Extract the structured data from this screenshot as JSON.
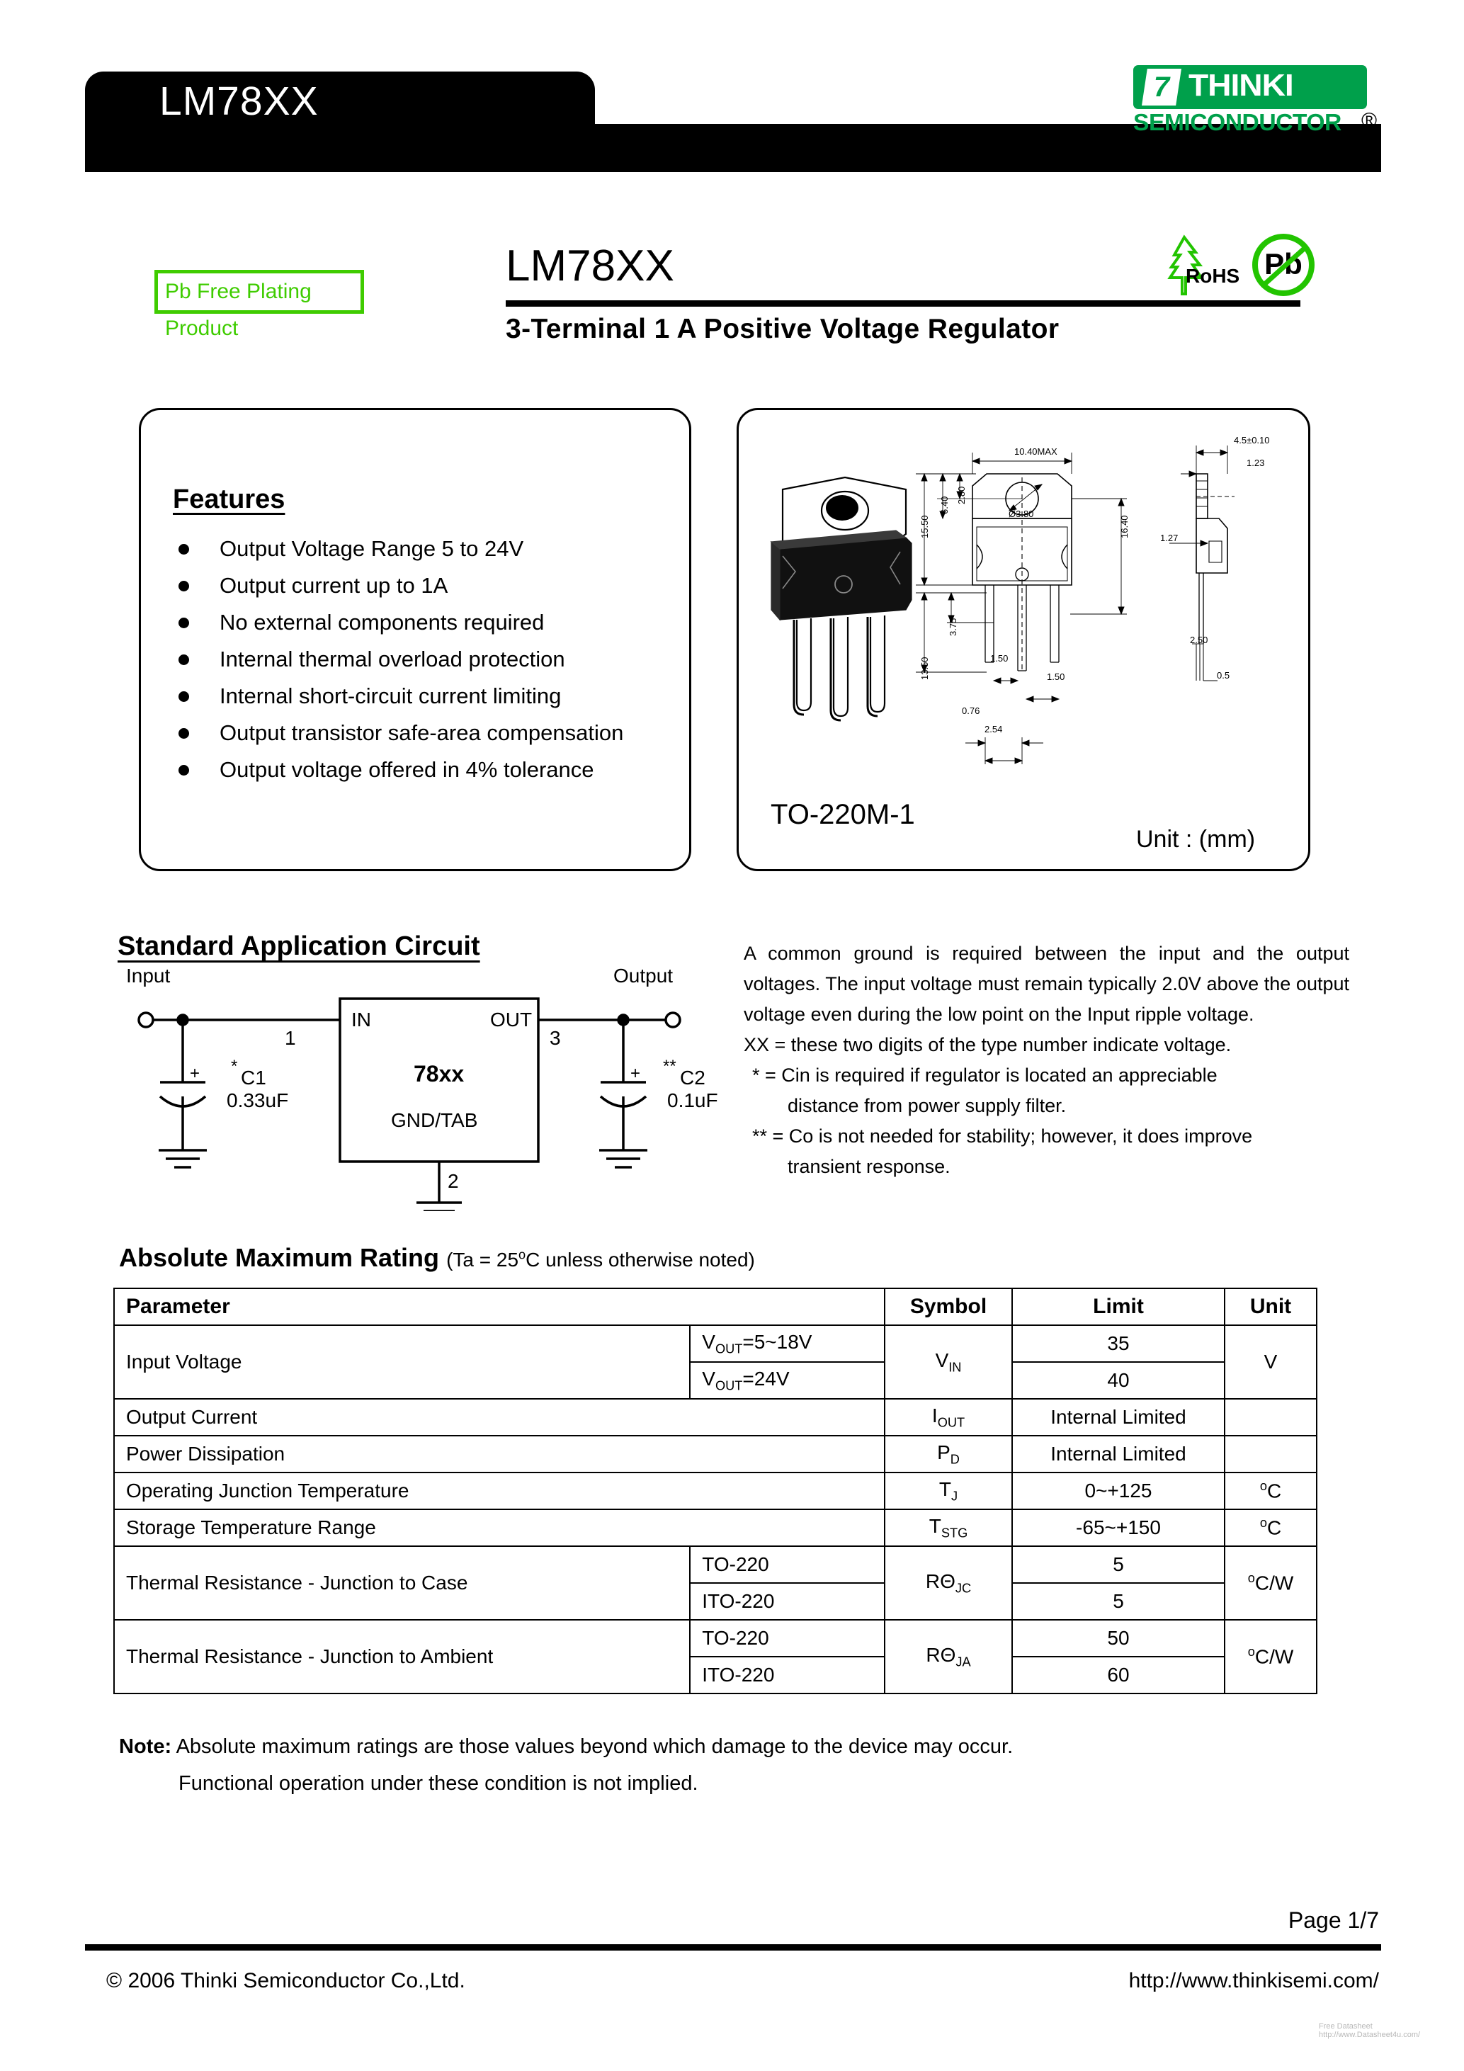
{
  "header": {
    "part_tab": "LM78XX",
    "logo": {
      "mark": "7",
      "brand": "THINKI",
      "sub": "SEMICONDUCTOR",
      "registered": "®",
      "green": "#00A04B"
    }
  },
  "title_block": {
    "pb_free_badge": "Pb Free Plating Product",
    "pb_free_color": "#3FCC00",
    "part_number": "LM78XX",
    "subtitle": "3-Terminal 1 A Positive Voltage Regulator",
    "rohs_label": "RoHS",
    "pb_badge_label": "Pb"
  },
  "features": {
    "heading": "Features",
    "items": [
      "Output Voltage Range 5 to 24V",
      "Output current up to 1A",
      "No external components required",
      "Internal thermal overload protection",
      "Internal short-circuit current limiting",
      "Output transistor safe-area compensation",
      "Output voltage offered in 4% tolerance"
    ]
  },
  "package": {
    "name": "TO-220M-1",
    "unit": "Unit : (mm)",
    "dimensions": {
      "width_max": "10.40MAX",
      "thickness": "4.5±0.10",
      "tab_thickness": "1.23",
      "hole_offset": "2.80",
      "upper_body": "6.40",
      "body_height": "15.50",
      "total_height": "16.40",
      "hole_dia": "Ø3.80",
      "shoulder": "3.75",
      "lead_length": "13.50",
      "side_step": "1.27",
      "lead_gap_a": "1.50",
      "lead_gap_b": "1.50",
      "lead_width": "0.76",
      "lead_pitch": "2.54",
      "lead_base": "2.50",
      "lead_thk": "0.5"
    }
  },
  "application_circuit": {
    "heading": "Standard Application Circuit",
    "input_label": "Input",
    "output_label": "Output",
    "pin1": "1",
    "pin2": "2",
    "pin3": "3",
    "in_label": "IN",
    "out_label": "OUT",
    "device": "78xx",
    "gnd_label": "GND/TAB",
    "c1_star": "*",
    "c1_name": "C1",
    "c1_value": "0.33uF",
    "c1_plus": "+",
    "c2_star": "**",
    "c2_name": "C2",
    "c2_value": "0.1uF",
    "c2_plus": "+"
  },
  "description": {
    "p1": "A common ground is required between the input and the output voltages. The input voltage must remain typically 2.0V above the output voltage even during the low point on the Input ripple voltage.",
    "p2": "XX = these two digits of the type number indicate voltage.",
    "p3a": "* = Cin is required if regulator is located an appreciable",
    "p3b": "distance from power supply filter.",
    "p4a": "** = Co is not needed for stability; however, it does improve",
    "p4b": "transient response."
  },
  "abs_max_rating": {
    "title": "Absolute Maximum Rating",
    "condition": "(Ta = 25°C unless otherwise noted)",
    "columns": [
      "Parameter",
      "Symbol",
      "Limit",
      "Unit"
    ],
    "rows": [
      {
        "parameter": "Input Voltage",
        "conditions": [
          "V_OUT=5~18V",
          "V_OUT=24V"
        ],
        "symbol": "V_IN",
        "limits": [
          "35",
          "40"
        ],
        "unit": "V"
      },
      {
        "parameter": "Output Current",
        "conditions": [],
        "symbol": "I_OUT",
        "limits": [
          "Internal Limited"
        ],
        "unit": ""
      },
      {
        "parameter": "Power Dissipation",
        "conditions": [],
        "symbol": "P_D",
        "limits": [
          "Internal Limited"
        ],
        "unit": ""
      },
      {
        "parameter": "Operating Junction Temperature",
        "conditions": [],
        "symbol": "T_J",
        "limits": [
          "0~+125"
        ],
        "unit": "°C"
      },
      {
        "parameter": "Storage Temperature Range",
        "conditions": [],
        "symbol": "T_STG",
        "limits": [
          "-65~+150"
        ],
        "unit": "°C"
      },
      {
        "parameter": "Thermal Resistance - Junction to Case",
        "conditions": [
          "TO-220",
          "ITO-220"
        ],
        "symbol": "RΘ_JC",
        "limits": [
          "5",
          "5"
        ],
        "unit": "°C/W"
      },
      {
        "parameter": "Thermal Resistance - Junction to Ambient",
        "conditions": [
          "TO-220",
          "ITO-220"
        ],
        "symbol": "RΘ_JA",
        "limits": [
          "50",
          "60"
        ],
        "unit": "°C/W"
      }
    ]
  },
  "note": {
    "label": "Note:",
    "line1": "Absolute maximum ratings are those values beyond which damage to the device may occur.",
    "line2": "Functional operation under these condition is not implied."
  },
  "footer": {
    "page": "Page 1/7",
    "copyright": "© 2006  Thinki  Semiconductor  Co.,Ltd.",
    "website": "http://www.thinkisemi.com/",
    "watermark": "Free Datasheet http://www.Datasheet4u.com/"
  }
}
